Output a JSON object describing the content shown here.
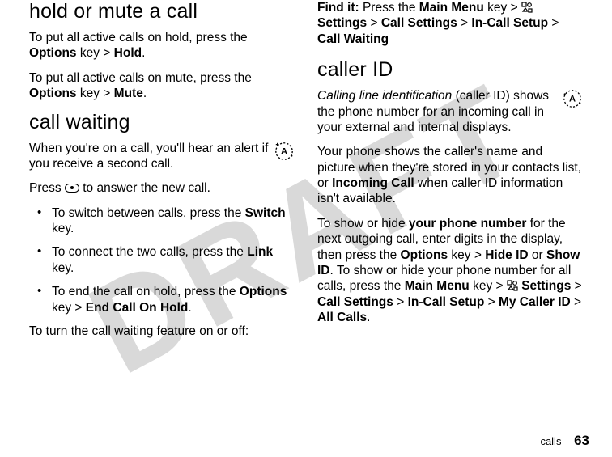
{
  "watermark": "DRAFT",
  "left": {
    "h1a": "hold or mute a call",
    "p1_a": "To put all active calls on hold, press the ",
    "p1_b": "Options",
    "p1_c": " key > ",
    "p1_d": "Hold",
    "p1_e": ".",
    "p2_a": "To put all active calls on mute, press the ",
    "p2_b": "Options",
    "p2_c": " key > ",
    "p2_d": "Mute",
    "p2_e": ".",
    "h1b": "call waiting",
    "p3": "When you're on a call, you'll hear an alert if you receive a second call.",
    "p4_a": "Press ",
    "p4_b": " to answer the new call.",
    "li1_a": "To switch between calls, press the ",
    "li1_b": "Switch",
    "li1_c": " key.",
    "li2_a": "To connect the two calls, press the ",
    "li2_b": "Link",
    "li2_c": " key.",
    "li3_a": "To end the call on hold, press the ",
    "li3_b": "Options",
    "li3_c": " key > ",
    "li3_d": "End Call On Hold",
    "li3_e": ".",
    "p5": "To turn the call waiting feature on or off:"
  },
  "right": {
    "find_a": "Find it:",
    "find_b": " Press the ",
    "find_c": "Main Menu",
    "find_d": " key > ",
    "find_e": "Settings",
    "find_f": " > ",
    "find_g": "Call Settings",
    "find_h": " > ",
    "find_i": "In-Call Setup",
    "find_j": " > ",
    "find_k": "Call Waiting",
    "h1": "caller ID",
    "p1_a": "Calling line identification",
    "p1_b": " (caller ID) shows the phone number for an incoming call in your external and internal displays.",
    "p2_a": "Your phone shows the caller's name and picture when they're stored in your contacts list, or ",
    "p2_b": "Incoming Call",
    "p2_c": " when caller ID information isn't available.",
    "p3_a": "To show or hide ",
    "p3_b": "your phone number",
    "p3_c": " for the next outgoing call, enter digits in the display, then press the ",
    "p3_d": "Options",
    "p3_e": " key > ",
    "p3_f": "Hide ID",
    "p3_g": " or ",
    "p3_h": "Show ID",
    "p3_i": ". To show or hide your phone number for all calls, press the ",
    "p3_j": "Main Menu",
    "p3_k": " key > ",
    "p3_l": "Settings",
    "p3_m": " > ",
    "p3_n": "Call Settings",
    "p3_o": " > ",
    "p3_p": "In-Call Setup",
    "p3_q": " > ",
    "p3_r": "My Caller ID",
    "p3_s": " > ",
    "p3_t": "All Calls",
    "p3_u": "."
  },
  "footer": {
    "section": "calls",
    "page": "63"
  }
}
